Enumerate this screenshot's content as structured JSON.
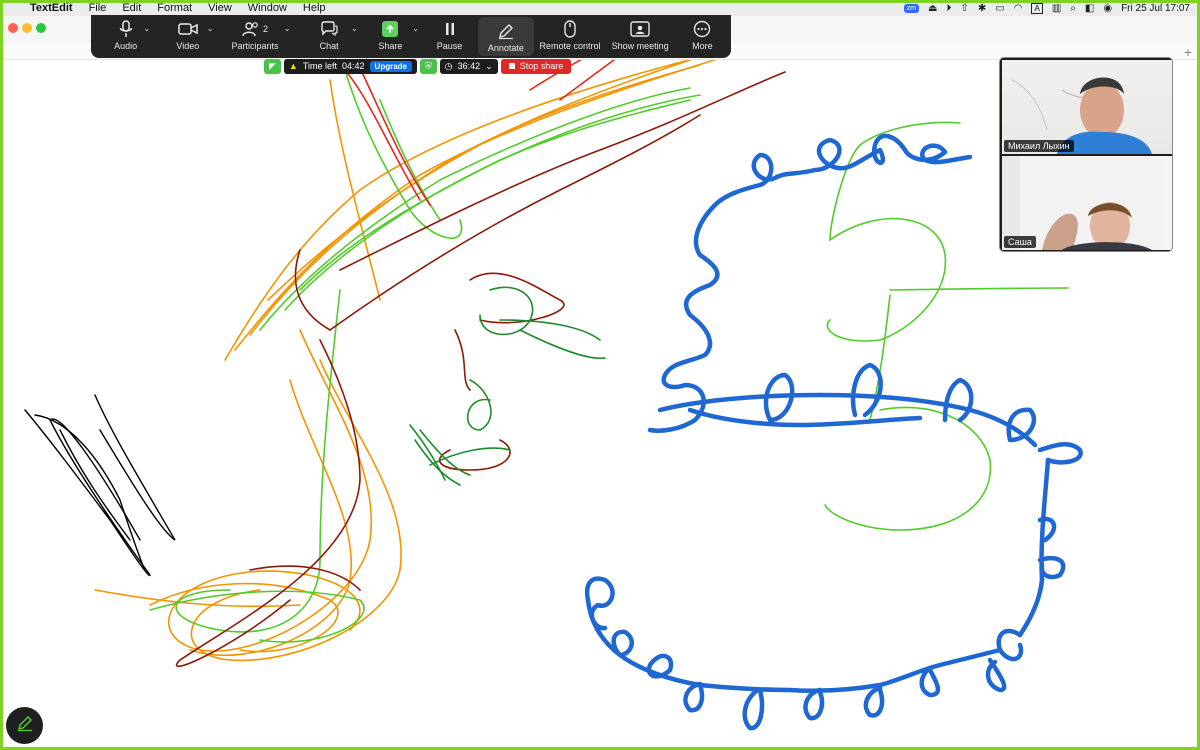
{
  "menubar": {
    "app_name": "TextEdit",
    "menus": [
      "File",
      "Edit",
      "Format",
      "View",
      "Window",
      "Help"
    ],
    "zoom_badge": "zm",
    "input_indicator": "A",
    "datetime": "Fri 25 Jul  17:07"
  },
  "toolbar": {
    "audio": "Audio",
    "video": "Video",
    "participants": "Participants",
    "participants_count": "2",
    "chat": "Chat",
    "share": "Share",
    "pause": "Pause",
    "annotate": "Annotate",
    "remote_control": "Remote control",
    "show_meeting": "Show meeting",
    "more": "More"
  },
  "share_status": {
    "time_left_label": "Time left",
    "time_left_value": "04:42",
    "upgrade": "Upgrade",
    "meeting_timer": "36:42",
    "stop_share": "Stop share"
  },
  "video": {
    "participant1": "Михаил Лыхин",
    "participant2": "Саша"
  },
  "colors": {
    "share_border": "#7ed321",
    "blue_ink": "#1f67d2",
    "green_ink": "#52cc2a",
    "orange_ink": "#f49400",
    "dark_red_ink": "#8b1a0a",
    "red_ink": "#e8261a",
    "dark_green_ink": "#1f8a2e",
    "black_ink": "#000000",
    "stop_share": "#e02828",
    "upgrade": "#0e71eb"
  },
  "icons": {
    "audio": "microphone-icon",
    "video": "camera-icon",
    "participants": "people-icon",
    "chat": "chat-bubble-icon",
    "share": "share-screen-icon",
    "pause": "pause-icon",
    "annotate": "pencil-icon",
    "remote_control": "mouse-icon",
    "show_meeting": "meeting-window-icon",
    "more": "more-dots-icon"
  }
}
